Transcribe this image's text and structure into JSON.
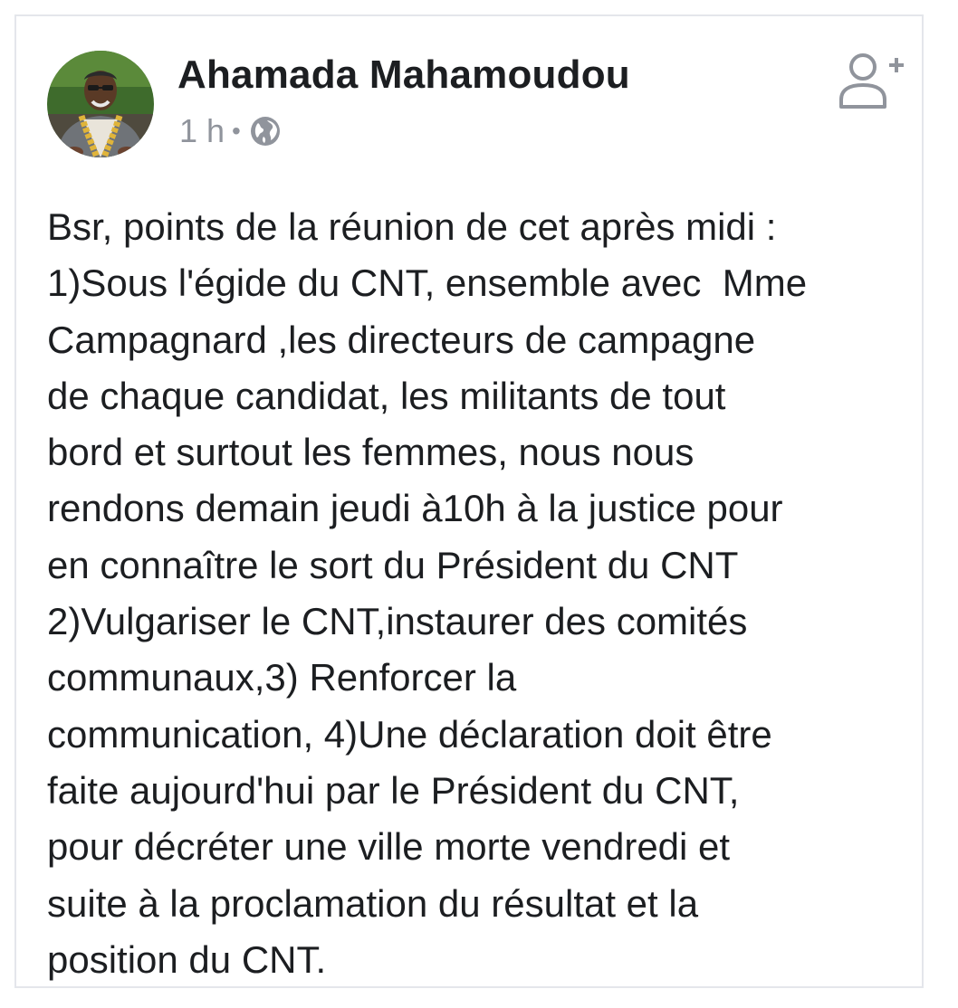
{
  "post": {
    "author": "Ahamada Mahamoudou",
    "time": "1 h",
    "separator": "•",
    "visibility_icon": "globe-icon",
    "add_friend_icon": "add-friend-icon",
    "lines": [
      "Bsr, points de la réunion de cet après midi :",
      "1)Sous l'égide du CNT, ensemble avec  Mme",
      "Campagnard ,les directeurs de campagne",
      "de chaque candidat, les militants de tout",
      "bord et surtout les femmes, nous nous",
      "rendons demain jeudi à10h à la justice pour",
      "en connaître le sort du Président du CNT",
      "2)Vulgariser le CNT,instaurer des comités",
      "communaux,3) Renforcer la",
      "communication, 4)Une déclaration doit être",
      "faite aujourd'hui par le Président du CNT,",
      "pour décréter une ville morte vendredi et",
      "suite à la proclamation du résultat et la",
      "position du CNT."
    ]
  },
  "colors": {
    "text": "#1c1e21",
    "meta": "#90949c",
    "border": "#e4e6eb",
    "icon": "#90949c"
  }
}
